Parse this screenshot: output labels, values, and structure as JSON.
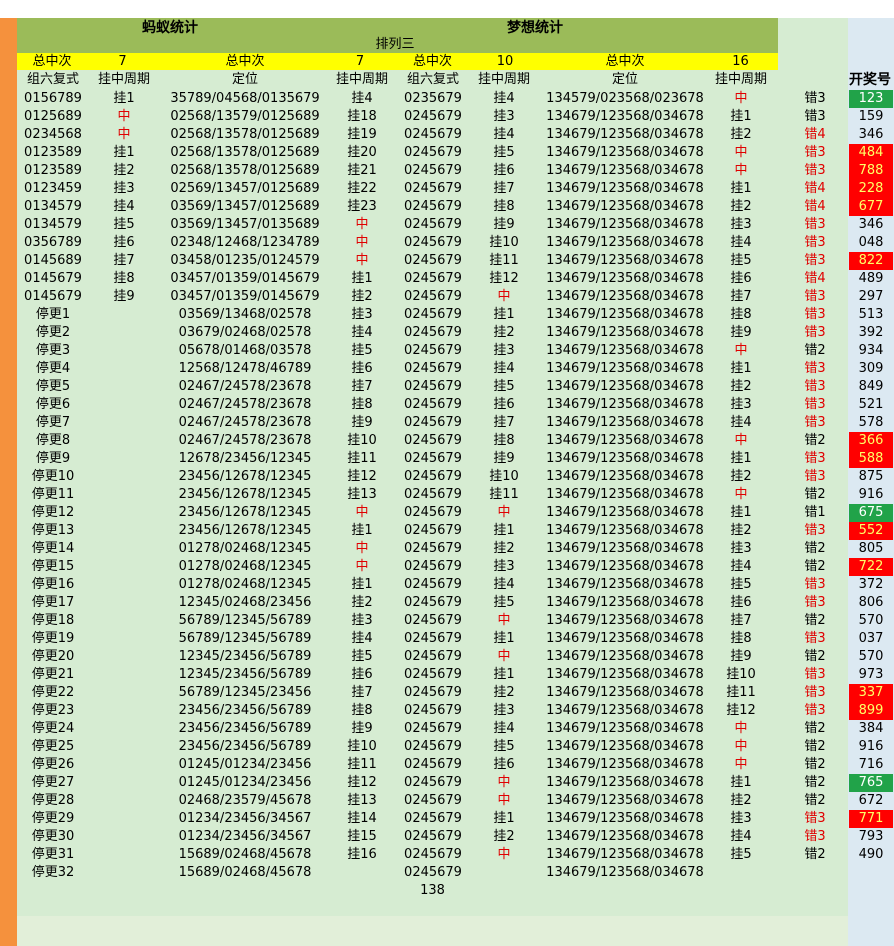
{
  "titles": {
    "left": "蚂蚁统计",
    "right": "梦想统计",
    "sub": "排列三"
  },
  "totals": {
    "label": "总中次",
    "ant_a": "7",
    "ant_b": "7",
    "dream_a": "10",
    "dream_b": "16"
  },
  "headers": {
    "c1": "组六复式",
    "c2": "挂中周期",
    "c3": "定位",
    "c4": "挂中周期",
    "c5": "组六复式",
    "c6": "挂中周期",
    "c7": "定位",
    "c8": "挂中周期",
    "c10": "开奖号"
  },
  "footer": {
    "value": "138"
  },
  "rows": [
    [
      "0156789",
      "挂1",
      "35789/04568/0135679",
      "挂4",
      "0235679",
      "挂4",
      "134579/023568/023678",
      "中",
      "错3",
      "123",
      "g"
    ],
    [
      "0125689",
      "中",
      "02568/13579/0125689",
      "挂18",
      "0245679",
      "挂3",
      "134679/123568/034678",
      "挂1",
      "错3",
      "159",
      ""
    ],
    [
      "0234568",
      "中",
      "02568/13578/0125689",
      "挂19",
      "0245679",
      "挂4",
      "134679/123568/034678",
      "挂2",
      "错4",
      "346",
      ""
    ],
    [
      "0123589",
      "挂1",
      "02568/13578/0125689",
      "挂20",
      "0245679",
      "挂5",
      "134679/123568/034678",
      "中",
      "错3",
      "484",
      "r"
    ],
    [
      "0123589",
      "挂2",
      "02568/13578/0125689",
      "挂21",
      "0245679",
      "挂6",
      "134679/123568/034678",
      "中",
      "错3",
      "788",
      "r"
    ],
    [
      "0123459",
      "挂3",
      "02569/13457/0125689",
      "挂22",
      "0245679",
      "挂7",
      "134679/123568/034678",
      "挂1",
      "错4",
      "228",
      "r"
    ],
    [
      "0134579",
      "挂4",
      "03569/13457/0125689",
      "挂23",
      "0245679",
      "挂8",
      "134679/123568/034678",
      "挂2",
      "错4",
      "677",
      "r"
    ],
    [
      "0134579",
      "挂5",
      "03569/13457/0135689",
      "中",
      "0245679",
      "挂9",
      "134679/123568/034678",
      "挂3",
      "错3",
      "346",
      ""
    ],
    [
      "0356789",
      "挂6",
      "02348/12468/1234789",
      "中",
      "0245679",
      "挂10",
      "134679/123568/034678",
      "挂4",
      "错3",
      "048",
      ""
    ],
    [
      "0145689",
      "挂7",
      "03458/01235/0124579",
      "中",
      "0245679",
      "挂11",
      "134679/123568/034678",
      "挂5",
      "错3",
      "822",
      "r"
    ],
    [
      "0145679",
      "挂8",
      "03457/01359/0145679",
      "挂1",
      "0245679",
      "挂12",
      "134679/123568/034678",
      "挂6",
      "错4",
      "489",
      ""
    ],
    [
      "0145679",
      "挂9",
      "03457/01359/0145679",
      "挂2",
      "0245679",
      "中",
      "134679/123568/034678",
      "挂7",
      "错3",
      "297",
      ""
    ],
    [
      "停更1",
      "",
      "03569/13468/02578",
      "挂3",
      "0245679",
      "挂1",
      "134679/123568/034678",
      "挂8",
      "错3",
      "513",
      ""
    ],
    [
      "停更2",
      "",
      "03679/02468/02578",
      "挂4",
      "0245679",
      "挂2",
      "134679/123568/034678",
      "挂9",
      "错3",
      "392",
      ""
    ],
    [
      "停更3",
      "",
      "05678/01468/03578",
      "挂5",
      "0245679",
      "挂3",
      "134679/123568/034678",
      "中",
      "错2",
      "934",
      ""
    ],
    [
      "停更4",
      "",
      "12568/12478/46789",
      "挂6",
      "0245679",
      "挂4",
      "134679/123568/034678",
      "挂1",
      "错3",
      "309",
      ""
    ],
    [
      "停更5",
      "",
      "02467/24578/23678",
      "挂7",
      "0245679",
      "挂5",
      "134679/123568/034678",
      "挂2",
      "错3",
      "849",
      ""
    ],
    [
      "停更6",
      "",
      "02467/24578/23678",
      "挂8",
      "0245679",
      "挂6",
      "134679/123568/034678",
      "挂3",
      "错3",
      "521",
      ""
    ],
    [
      "停更7",
      "",
      "02467/24578/23678",
      "挂9",
      "0245679",
      "挂7",
      "134679/123568/034678",
      "挂4",
      "错3",
      "578",
      ""
    ],
    [
      "停更8",
      "",
      "02467/24578/23678",
      "挂10",
      "0245679",
      "挂8",
      "134679/123568/034678",
      "中",
      "错2",
      "366",
      "r"
    ],
    [
      "停更9",
      "",
      "12678/23456/12345",
      "挂11",
      "0245679",
      "挂9",
      "134679/123568/034678",
      "挂1",
      "错3",
      "588",
      "r"
    ],
    [
      "停更10",
      "",
      "23456/12678/12345",
      "挂12",
      "0245679",
      "挂10",
      "134679/123568/034678",
      "挂2",
      "错3",
      "875",
      ""
    ],
    [
      "停更11",
      "",
      "23456/12678/12345",
      "挂13",
      "0245679",
      "挂11",
      "134679/123568/034678",
      "中",
      "错2",
      "916",
      ""
    ],
    [
      "停更12",
      "",
      "23456/12678/12345",
      "中",
      "0245679",
      "中",
      "134679/123568/034678",
      "挂1",
      "错1",
      "675",
      "g"
    ],
    [
      "停更13",
      "",
      "23456/12678/12345",
      "挂1",
      "0245679",
      "挂1",
      "134679/123568/034678",
      "挂2",
      "错3",
      "552",
      "r"
    ],
    [
      "停更14",
      "",
      "01278/02468/12345",
      "中",
      "0245679",
      "挂2",
      "134679/123568/034678",
      "挂3",
      "错2",
      "805",
      ""
    ],
    [
      "停更15",
      "",
      "01278/02468/12345",
      "中",
      "0245679",
      "挂3",
      "134679/123568/034678",
      "挂4",
      "错2",
      "722",
      "r"
    ],
    [
      "停更16",
      "",
      "01278/02468/12345",
      "挂1",
      "0245679",
      "挂4",
      "134679/123568/034678",
      "挂5",
      "错3",
      "372",
      ""
    ],
    [
      "停更17",
      "",
      "12345/02468/23456",
      "挂2",
      "0245679",
      "挂5",
      "134679/123568/034678",
      "挂6",
      "错3",
      "806",
      ""
    ],
    [
      "停更18",
      "",
      "56789/12345/56789",
      "挂3",
      "0245679",
      "中",
      "134679/123568/034678",
      "挂7",
      "错2",
      "570",
      ""
    ],
    [
      "停更19",
      "",
      "56789/12345/56789",
      "挂4",
      "0245679",
      "挂1",
      "134679/123568/034678",
      "挂8",
      "错3",
      "037",
      ""
    ],
    [
      "停更20",
      "",
      "12345/23456/56789",
      "挂5",
      "0245679",
      "中",
      "134679/123568/034678",
      "挂9",
      "错2",
      "570",
      ""
    ],
    [
      "停更21",
      "",
      "12345/23456/56789",
      "挂6",
      "0245679",
      "挂1",
      "134679/123568/034678",
      "挂10",
      "错3",
      "973",
      ""
    ],
    [
      "停更22",
      "",
      "56789/12345/23456",
      "挂7",
      "0245679",
      "挂2",
      "134679/123568/034678",
      "挂11",
      "错3",
      "337",
      "r"
    ],
    [
      "停更23",
      "",
      "23456/23456/56789",
      "挂8",
      "0245679",
      "挂3",
      "134679/123568/034678",
      "挂12",
      "错3",
      "899",
      "r"
    ],
    [
      "停更24",
      "",
      "23456/23456/56789",
      "挂9",
      "0245679",
      "挂4",
      "134679/123568/034678",
      "中",
      "错2",
      "384",
      ""
    ],
    [
      "停更25",
      "",
      "23456/23456/56789",
      "挂10",
      "0245679",
      "挂5",
      "134679/123568/034678",
      "中",
      "错2",
      "916",
      ""
    ],
    [
      "停更26",
      "",
      "01245/01234/23456",
      "挂11",
      "0245679",
      "挂6",
      "134679/123568/034678",
      "中",
      "错2",
      "716",
      ""
    ],
    [
      "停更27",
      "",
      "01245/01234/23456",
      "挂12",
      "0245679",
      "中",
      "134679/123568/034678",
      "挂1",
      "错2",
      "765",
      "g"
    ],
    [
      "停更28",
      "",
      "02468/23579/45678",
      "挂13",
      "0245679",
      "中",
      "134679/123568/034678",
      "挂2",
      "错2",
      "672",
      ""
    ],
    [
      "停更29",
      "",
      "01234/23456/34567",
      "挂14",
      "0245679",
      "挂1",
      "134679/123568/034678",
      "挂3",
      "错3",
      "771",
      "r"
    ],
    [
      "停更30",
      "",
      "01234/23456/34567",
      "挂15",
      "0245679",
      "挂2",
      "134679/123568/034678",
      "挂4",
      "错3",
      "793",
      ""
    ],
    [
      "停更31",
      "",
      "15689/02468/45678",
      "挂16",
      "0245679",
      "中",
      "134679/123568/034678",
      "挂5",
      "错2",
      "490",
      ""
    ],
    [
      "停更32",
      "",
      "15689/02468/45678",
      "",
      "0245679",
      "",
      "134679/123568/034678",
      "",
      "",
      "",
      ""
    ]
  ],
  "colors": {
    "orange": "#f5913d",
    "green_bg": "#d6ecd2",
    "header_green": "#9bbb59",
    "yellow": "#ffff00",
    "red": "#ff0000",
    "hit_green": "#21a349"
  }
}
